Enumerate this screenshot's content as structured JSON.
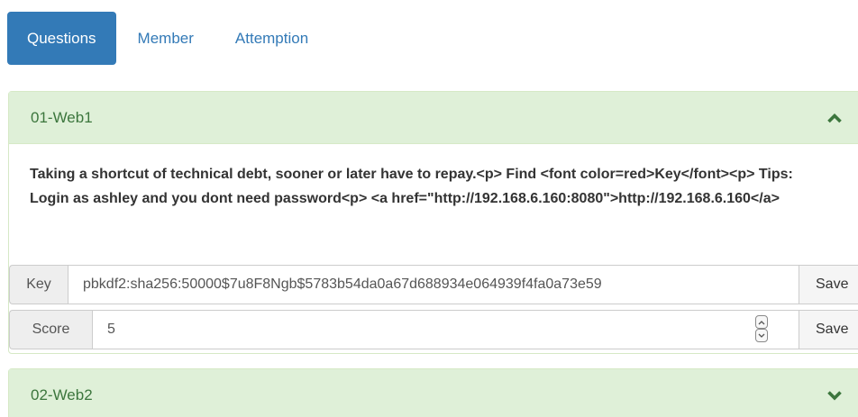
{
  "tabs": [
    {
      "label": "Questions",
      "active": true
    },
    {
      "label": "Member",
      "active": false
    },
    {
      "label": "Attemption",
      "active": false
    }
  ],
  "questions": [
    {
      "title": "01-Web1",
      "expanded": true,
      "chevron_icon": "chevron-up-icon",
      "description": "Taking a shortcut of technical debt, sooner or later have to repay.<p> Find <font color=red>Key</font><p> Tips: Login as ashley and you dont need password<p> <a href=\"http://192.168.6.160:8080\">http://192.168.6.160</a>",
      "key_label": "Key",
      "key_value": "pbkdf2:sha256:50000$7u8F8Ngb$5783b54da0a67d688934e064939f4fa0a73e59",
      "key_save_label": "Save",
      "score_label": "Score",
      "score_value": "5",
      "score_save_label": "Save"
    },
    {
      "title": "02-Web2",
      "expanded": false,
      "chevron_icon": "chevron-down-icon"
    }
  ],
  "colors": {
    "primary": "#337ab7",
    "panel_heading_bg": "#dff0d8",
    "panel_heading_text": "#3c763d",
    "panel_border": "#d6e9c6"
  }
}
